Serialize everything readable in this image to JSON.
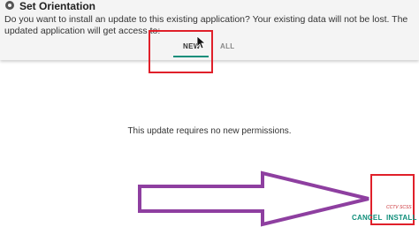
{
  "header": {
    "title": "Set Orientation",
    "app_icon": "settings-gear-icon",
    "prompt": "Do you want to install an update to this existing application? Your existing data will not be lost. The updated application will get access to:"
  },
  "tabs": [
    {
      "label": "NEW",
      "selected": true
    },
    {
      "label": "ALL",
      "selected": false
    }
  ],
  "body": {
    "message": "This update requires no new permissions."
  },
  "annotations": {
    "watermark": "CCTV SCSS",
    "highlight_color": "#e0202a",
    "arrow_color": "#8e3fa0"
  },
  "footer": {
    "cancel_label": "CANCEL",
    "install_label": "INSTALL"
  },
  "colors": {
    "accent": "#0f8e7a"
  }
}
